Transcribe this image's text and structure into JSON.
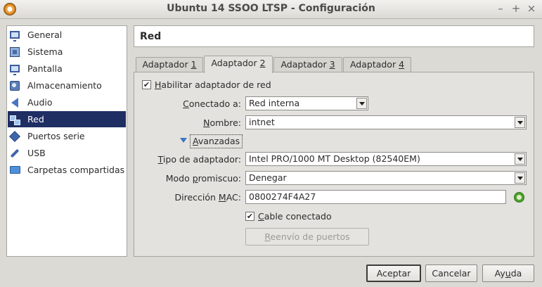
{
  "window": {
    "title": "Ubuntu 14 SSOO LTSP - Configuración",
    "controls": [
      "–",
      "+",
      "×"
    ]
  },
  "sidebar": {
    "items": [
      {
        "label": "General",
        "icon": "monitor-icon"
      },
      {
        "label": "Sistema",
        "icon": "chip-icon"
      },
      {
        "label": "Pantalla",
        "icon": "display-icon"
      },
      {
        "label": "Almacenamiento",
        "icon": "disk-icon"
      },
      {
        "label": "Audio",
        "icon": "speaker-icon"
      },
      {
        "label": "Red",
        "icon": "network-icon",
        "selected": true
      },
      {
        "label": "Puertos serie",
        "icon": "serial-port-icon"
      },
      {
        "label": "USB",
        "icon": "usb-icon"
      },
      {
        "label": "Carpetas compartidas",
        "icon": "folder-icon"
      }
    ]
  },
  "header": {
    "title": "Red"
  },
  "tabs": [
    {
      "prefix": "Adaptador ",
      "key": "1"
    },
    {
      "prefix": "Adaptador ",
      "key": "2",
      "active": true
    },
    {
      "prefix": "Adaptador ",
      "key": "3"
    },
    {
      "prefix": "Adaptador ",
      "key": "4"
    }
  ],
  "form": {
    "enable_prefix": "H",
    "enable_rest": "abilitar adaptador de red",
    "enable_checked": "✔",
    "attached_label_u": "C",
    "attached_label_rest": "onectado a:",
    "attached_value": "Red interna",
    "name_label_u": "N",
    "name_label_rest": "ombre:",
    "name_value": "intnet",
    "advanced_label_u": "A",
    "advanced_label_rest": "vanzadas",
    "adapter_label_u": "T",
    "adapter_label_rest": "ipo de adaptador:",
    "adapter_value": "Intel PRO/1000 MT Desktop (82540EM)",
    "promisc_label_pre": "Modo ",
    "promisc_label_u": "p",
    "promisc_label_rest": "romiscuo:",
    "promisc_value": "Denegar",
    "mac_label_pre": "Dirección ",
    "mac_label_u": "M",
    "mac_label_rest": "AC:",
    "mac_value": "0800274F4A27",
    "cable_label_u": "C",
    "cable_label_rest": "able conectado",
    "cable_checked": "✔",
    "port_forward_u": "R",
    "port_forward_rest": "eenvío de puertos"
  },
  "buttons": {
    "accept": "Aceptar",
    "cancel": "Cancelar",
    "help_pre": "Ay",
    "help_u": "u",
    "help_rest": "da"
  },
  "colors": {
    "selection": "#1f2e63",
    "panel": "#e4e2de",
    "window": "#dcdad5"
  }
}
